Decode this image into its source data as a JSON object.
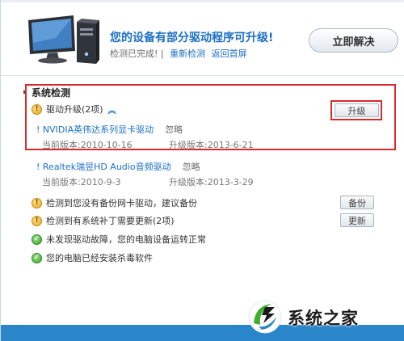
{
  "header": {
    "title": "您的设备有部分驱动程序可升级!",
    "status": "检测已完成!",
    "recheck_link": "重新检测",
    "home_link": "返回首屏",
    "fix_button": "立即解决"
  },
  "section": {
    "title": "系统检测"
  },
  "driver_upgrade": {
    "label": "驱动升级(2项)",
    "upgrade_button": "升级",
    "drivers": [
      {
        "name": "! NVIDIA英伟达系列显卡驱动",
        "ignore": "忽略",
        "current": "当前版本:2010-10-16",
        "available": "升级版本:2013-6-21"
      },
      {
        "name": "! Realtek瑞昱HD Audio音频驱动",
        "ignore": "忽略",
        "current": "当前版本:2010-9-3",
        "available": "升级版本:2013-3-29"
      }
    ]
  },
  "checks": [
    {
      "text": "检测到您没有备份网卡驱动，建议备份",
      "status": "warning",
      "button": "备份"
    },
    {
      "text": "检测到有系统补丁需要更新(2项)",
      "status": "warning",
      "button": "更新"
    },
    {
      "text": "未发现驱动故障，您的电脑设备运转正常",
      "status": "ok"
    },
    {
      "text": "您的电脑已经安装杀毒软件",
      "status": "ok"
    }
  ],
  "watermark": {
    "text": "系统之家"
  },
  "colors": {
    "accent": "#1c70c4",
    "highlight": "#d92b2b",
    "bottom_bar": "#2a86c9"
  }
}
